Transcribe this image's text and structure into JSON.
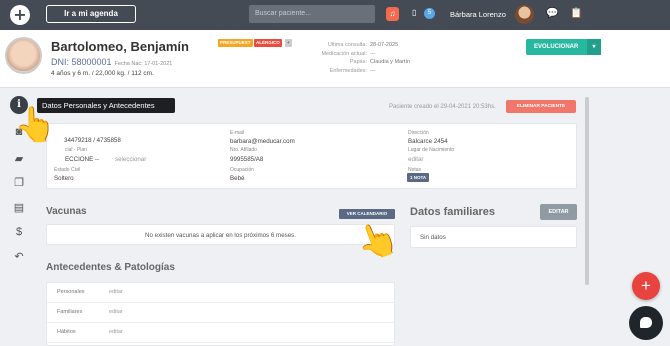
{
  "topbar": {
    "agenda_button": "Ir a mi agenda",
    "search_placeholder": "Buscar paciente...",
    "message_count": "5",
    "user_name": "Bárbara Lorenzo"
  },
  "patient": {
    "name": "Bartolomeo, Benjamín",
    "dni": "DNI: 58000001",
    "birth": "Fecha Nac: 17-01-2021",
    "age_info": "4 años y 6 m. / 22,000 kg. / 112 cm.",
    "tags": [
      {
        "label": "PRESUPUEST",
        "color": "#f5a623"
      },
      {
        "label": "ALÉRGICO",
        "color": "#e94b3c"
      },
      {
        "label": "+",
        "color": "#cccccc"
      }
    ],
    "meta": [
      {
        "k": "Ultima consulta:",
        "v": "28-07-2025"
      },
      {
        "k": "Medicación actual:",
        "v": "---"
      },
      {
        "k": "Papás:",
        "v": "Claudia y Martín"
      },
      {
        "k": "Enfermedades:",
        "v": "---"
      }
    ],
    "evolve_button": "EVOLUCIONAR",
    "evolve_caret": "▾"
  },
  "tooltip": "Datos Personales y Antecedentes",
  "personal": {
    "created": "Paciente creado el 29-04-2021 20:53hs.",
    "delete_button": "ELIMINAR PACIENTE",
    "phone": "34479218  /  4735858",
    "email_label": "E-mail",
    "email": "barbara@meducar.com",
    "address_label": "Dirección",
    "address": "Balcarce 2454",
    "plan_label": "cial - Plan",
    "plan_value": "ECCIONE --",
    "plan_select": "seleccionar",
    "affiliate_label": "Nro. Afiliado",
    "affiliate": "9995585/A8",
    "birthplace_label": "Lugar de Nacimiento",
    "birthplace_edit": "editar",
    "civil_label": "Estado Civil",
    "civil": "Soltero",
    "occupation_label": "Ocupación",
    "occupation": "Bebé",
    "notes_label": "Notas",
    "notes_badge": "1 NOTA"
  },
  "vacunas": {
    "title": "Vacunas",
    "calendar_button": "VER CALENDARIO",
    "empty": "No existen vacunas a aplicar en los próximos 6 meses."
  },
  "familiares": {
    "title": "Datos familiares",
    "edit_button": "EDITAR",
    "empty": "Sin datos"
  },
  "antecedentes": {
    "title": "Antecedentes & Patologías",
    "rows": [
      {
        "name": "Personales",
        "action": "editar"
      },
      {
        "name": "Familiares",
        "action": "editar"
      },
      {
        "name": "Hábitos",
        "action": "editar"
      }
    ]
  },
  "fab": "+"
}
